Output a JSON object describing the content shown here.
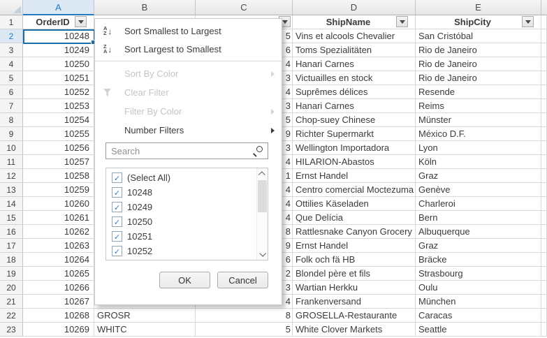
{
  "colors": {
    "accent_blue": "#2779bd",
    "selection_border": "#1c6ea8",
    "checkmark_blue": "#2d7dd2",
    "disabled_gray": "#c4c4c4",
    "header_strip": "#e9e9e9"
  },
  "sheet": {
    "column_letters": [
      "A",
      "B",
      "C",
      "D",
      "E"
    ],
    "selected_column": "A",
    "header_row": {
      "n": "1",
      "a": "OrderID",
      "d": "ShipName",
      "e": "ShipCity"
    },
    "rows": [
      {
        "n": "2",
        "a": "10248",
        "b": "",
        "c": "5",
        "d": "Vins et alcools Chevalier",
        "e": "San Cristóbal"
      },
      {
        "n": "3",
        "a": "10249",
        "b": "",
        "c": "6",
        "d": "Toms Spezialitäten",
        "e": "Rio de Janeiro"
      },
      {
        "n": "4",
        "a": "10250",
        "b": "",
        "c": "4",
        "d": "Hanari Carnes",
        "e": "Rio de Janeiro"
      },
      {
        "n": "5",
        "a": "10251",
        "b": "",
        "c": "3",
        "d": "Victuailles en stock",
        "e": "Rio de Janeiro"
      },
      {
        "n": "6",
        "a": "10252",
        "b": "",
        "c": "4",
        "d": "Suprêmes délices",
        "e": "Resende"
      },
      {
        "n": "7",
        "a": "10253",
        "b": "",
        "c": "3",
        "d": "Hanari Carnes",
        "e": "Reims"
      },
      {
        "n": "8",
        "a": "10254",
        "b": "",
        "c": "5",
        "d": "Chop-suey Chinese",
        "e": "Münster"
      },
      {
        "n": "9",
        "a": "10255",
        "b": "",
        "c": "9",
        "d": "Richter Supermarkt",
        "e": "México D.F."
      },
      {
        "n": "10",
        "a": "10256",
        "b": "",
        "c": "3",
        "d": "Wellington Importadora",
        "e": "Lyon"
      },
      {
        "n": "11",
        "a": "10257",
        "b": "",
        "c": "4",
        "d": "HILARION-Abastos",
        "e": "Köln"
      },
      {
        "n": "12",
        "a": "10258",
        "b": "",
        "c": "1",
        "d": "Ernst Handel",
        "e": "Graz"
      },
      {
        "n": "13",
        "a": "10259",
        "b": "",
        "c": "4",
        "d": "Centro comercial Moctezuma",
        "e": "Genève"
      },
      {
        "n": "14",
        "a": "10260",
        "b": "",
        "c": "4",
        "d": "Ottilies Käseladen",
        "e": "Charleroi"
      },
      {
        "n": "15",
        "a": "10261",
        "b": "",
        "c": "4",
        "d": "Que Delícia",
        "e": "Bern"
      },
      {
        "n": "16",
        "a": "10262",
        "b": "",
        "c": "8",
        "d": "Rattlesnake Canyon Grocery",
        "e": "Albuquerque"
      },
      {
        "n": "17",
        "a": "10263",
        "b": "",
        "c": "9",
        "d": "Ernst Handel",
        "e": "Graz"
      },
      {
        "n": "18",
        "a": "10264",
        "b": "",
        "c": "6",
        "d": "Folk och fä HB",
        "e": "Bräcke"
      },
      {
        "n": "19",
        "a": "10265",
        "b": "",
        "c": "2",
        "d": "Blondel père et fils",
        "e": "Strasbourg"
      },
      {
        "n": "20",
        "a": "10266",
        "b": "",
        "c": "3",
        "d": "Wartian Herkku",
        "e": "Oulu"
      },
      {
        "n": "21",
        "a": "10267",
        "b": "",
        "c": "4",
        "d": "Frankenversand",
        "e": "München"
      },
      {
        "n": "22",
        "a": "10268",
        "b": "GROSR",
        "c": "8",
        "d": "GROSELLA-Restaurante",
        "e": "Caracas"
      },
      {
        "n": "23",
        "a": "10269",
        "b": "WHITC",
        "c": "5",
        "d": "White Clover Markets",
        "e": "Seattle"
      }
    ]
  },
  "filter_menu": {
    "sort_az_label": "Sort Smallest to Largest",
    "sort_za_label": "Sort Largest to Smallest",
    "sort_by_color_label": "Sort By Color",
    "clear_filter_label": "Clear Filter",
    "filter_by_color_label": "Filter By Color",
    "number_filters_label": "Number Filters",
    "search_placeholder": "Search",
    "checklist": [
      {
        "label": "(Select All)",
        "checked": true
      },
      {
        "label": "10248",
        "checked": true
      },
      {
        "label": "10249",
        "checked": true
      },
      {
        "label": "10250",
        "checked": true
      },
      {
        "label": "10251",
        "checked": true
      },
      {
        "label": "10252",
        "checked": true
      }
    ],
    "ok_label": "OK",
    "cancel_label": "Cancel"
  }
}
